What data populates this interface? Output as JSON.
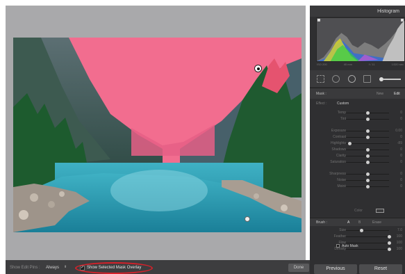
{
  "toolbar": {
    "show_edit_pins_label": "Show Edit Pins :",
    "show_edit_pins_value": "Always",
    "overlay_checked": true,
    "overlay_label": "Show Selected Mask Overlay",
    "done_label": "Done"
  },
  "panel": {
    "title": "Histogram",
    "histogram_info": [
      "ISO 200",
      "40 mm",
      "f / 11",
      "1/320 sec"
    ],
    "mask_label": "Mask :",
    "mask_new": "New",
    "mask_edit": "Edit",
    "effect_label": "Effect :",
    "effect_value": "Custom",
    "sliders": [
      {
        "label": "Temp",
        "value": "0",
        "pos": 0.5
      },
      {
        "label": "Tint",
        "value": "0",
        "pos": 0.5
      },
      {
        "label": "Exposure",
        "value": "0.00",
        "pos": 0.5
      },
      {
        "label": "Contrast",
        "value": "0",
        "pos": 0.5
      },
      {
        "label": "Highlights",
        "value": "-89",
        "pos": 0.08
      },
      {
        "label": "Shadows",
        "value": "0",
        "pos": 0.5
      },
      {
        "label": "Clarity",
        "value": "0",
        "pos": 0.5
      },
      {
        "label": "Saturation",
        "value": "0",
        "pos": 0.5
      },
      {
        "label": "Sharpness",
        "value": "0",
        "pos": 0.5
      },
      {
        "label": "Noise",
        "value": "0",
        "pos": 0.5
      },
      {
        "label": "Moiré",
        "value": "0",
        "pos": 0.5
      }
    ],
    "color_label": "Color",
    "brush_label": "Brush :",
    "brush_a": "A",
    "brush_b": "B",
    "brush_erase": "Erase",
    "brush_sliders": [
      {
        "label": "Size",
        "value": "7.0",
        "pos": 0.35
      },
      {
        "label": "Feather",
        "value": "100",
        "pos": 1.0
      },
      {
        "label": "Flow",
        "value": "100",
        "pos": 1.0
      },
      {
        "label": "Density",
        "value": "100",
        "pos": 1.0
      }
    ],
    "automask_checked": true,
    "automask_label": "Auto Mask",
    "previous_label": "Previous",
    "reset_label": "Reset"
  }
}
